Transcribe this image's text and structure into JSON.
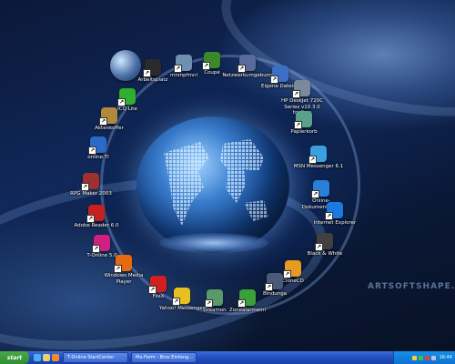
{
  "desktop": {
    "watermark": "ARTSOFTSHAPE.COM",
    "icons": [
      {
        "label": "",
        "icon": "globe-orb-icon",
        "color": "#4a6fa5"
      },
      {
        "label": "Arbeitsplatz",
        "icon": "computer-icon",
        "color": "#2a2a2a"
      },
      {
        "label": "mnmpfmnl",
        "icon": "program-icon",
        "color": "#6f8fb0"
      },
      {
        "label": "Coupé",
        "icon": "snake-icon",
        "color": "#3a8a2a"
      },
      {
        "label": "Netzwerkumgebung",
        "icon": "network-icon",
        "color": "#5a6a9a"
      },
      {
        "label": "ICQ Lite",
        "icon": "flower-icon",
        "color": "#2fae2f"
      },
      {
        "label": "Eigene Dateien",
        "icon": "documents-icon",
        "color": "#3c6ec8"
      },
      {
        "label": "HP DeskJet 720C Series v10.3.0 toolbox",
        "icon": "printer-icon",
        "color": "#7a8a9a"
      },
      {
        "label": "Aktenkoffer",
        "icon": "briefcase-icon",
        "color": "#b08a3a"
      },
      {
        "label": "Papierkorb",
        "icon": "recycle-bin-icon",
        "color": "#5aa08a"
      },
      {
        "label": "online.TI",
        "icon": "globe-icon",
        "color": "#2a6ac8"
      },
      {
        "label": "MSN Messenger 6.1",
        "icon": "msn-messenger-icon",
        "color": "#3aa0e0"
      },
      {
        "label": "Online-Dokumentation",
        "icon": "book-icon",
        "color": "#2a80d8"
      },
      {
        "label": "RPG Maker 2003",
        "icon": "rpg-maker-icon",
        "color": "#a03030"
      },
      {
        "label": "Internet Explorer",
        "icon": "internet-explorer-icon",
        "color": "#1a7ae0"
      },
      {
        "label": "Adobe Reader 6.0",
        "icon": "adobe-reader-icon",
        "color": "#c82020"
      },
      {
        "label": "Black & White",
        "icon": "game-icon",
        "color": "#404040"
      },
      {
        "label": "T-Online 5.0",
        "icon": "t-online-icon",
        "color": "#d02080"
      },
      {
        "label": "CloneCD",
        "icon": "clonecd-icon",
        "color": "#e89a20"
      },
      {
        "label": "Windows Media Player",
        "icon": "media-player-icon",
        "color": "#e86a10"
      },
      {
        "label": "Bindunga",
        "icon": "disk-icon",
        "color": "#4a5a7a"
      },
      {
        "label": "FileX",
        "icon": "filex-icon",
        "color": "#d02020"
      },
      {
        "label": "Yahoo! Messenger",
        "icon": "yahoo-messenger-icon",
        "color": "#e8c020"
      },
      {
        "label": "Dreamon",
        "icon": "dreamon-icon",
        "color": "#5a9a6a"
      },
      {
        "label": "Zonealarmeml",
        "icon": "zonealarm-icon",
        "color": "#3aa03a"
      }
    ]
  },
  "taskbar": {
    "start_label": "start",
    "quick_launch": [
      {
        "icon": "ie-quicklaunch-icon",
        "color": "#4ab0f0"
      },
      {
        "icon": "desktop-quicklaunch-icon",
        "color": "#e8d070"
      },
      {
        "icon": "mediaplayer-quicklaunch-icon",
        "color": "#f08a30"
      }
    ],
    "tasks": [
      {
        "label": "T-Online StartCenter"
      },
      {
        "label": "Mx-Form - Bros Einfang..."
      }
    ],
    "tray_icons": [
      {
        "icon": "tray-icon-1",
        "color": "#f0d040"
      },
      {
        "icon": "tray-icon-2",
        "color": "#40c040"
      },
      {
        "icon": "tray-icon-3",
        "color": "#e04040"
      },
      {
        "icon": "tray-icon-4",
        "color": "#c0c0f0"
      }
    ],
    "clock": "16:44"
  }
}
